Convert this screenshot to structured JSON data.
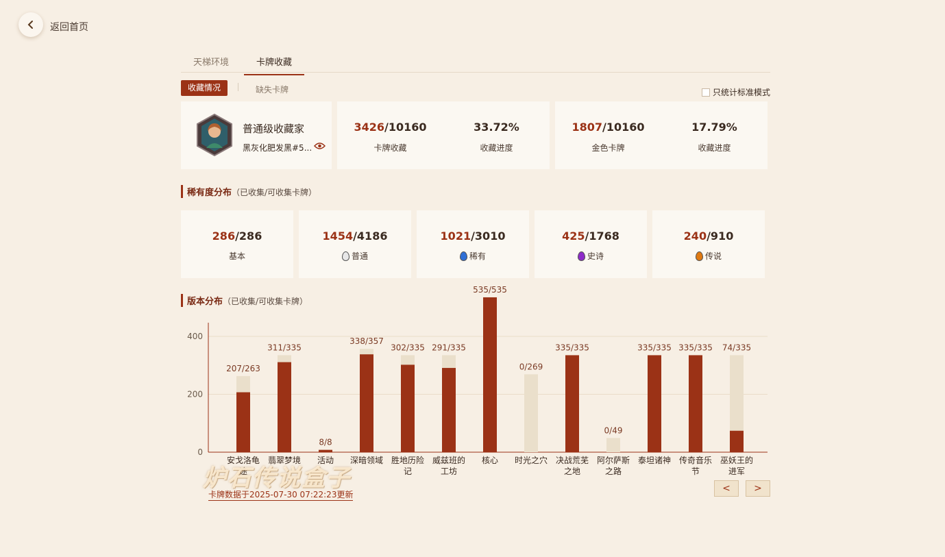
{
  "nav": {
    "back_label": "返回首页"
  },
  "tabs": [
    {
      "label": "天梯环境"
    },
    {
      "label": "卡牌收藏"
    }
  ],
  "subtabs": {
    "active": "收藏情况",
    "other": "缺失卡牌"
  },
  "standard_only_label": "只统计标准模式",
  "profile": {
    "title": "普通级收藏家",
    "player": "黑灰化肥发黑#5...",
    "eye_icon": "eye-icon",
    "accent": "#9b3216"
  },
  "stats": {
    "cards": {
      "owned": "3426",
      "total": "/10160",
      "label": "卡牌收藏",
      "pct": "33.72%",
      "pct_label": "收藏进度"
    },
    "golden": {
      "owned": "1807",
      "total": "/10160",
      "label": "金色卡牌",
      "pct": "17.79%",
      "pct_label": "收藏进度"
    }
  },
  "rarity_section": {
    "title": "稀有度分布",
    "note": "（已收集/可收集卡牌）"
  },
  "rarity": [
    {
      "owned": "286",
      "total": "/286",
      "label": "基本",
      "gem": ""
    },
    {
      "owned": "1454",
      "total": "/4186",
      "label": "普通",
      "gem": "#e8e8e8"
    },
    {
      "owned": "1021",
      "total": "/3010",
      "label": "稀有",
      "gem": "#2f6fd6"
    },
    {
      "owned": "425",
      "total": "/1768",
      "label": "史诗",
      "gem": "#8e2bc9"
    },
    {
      "owned": "240",
      "total": "/910",
      "label": "传说",
      "gem": "#e07a12"
    }
  ],
  "version_section": {
    "title": "版本分布",
    "note": "（已收集/可收集卡牌）"
  },
  "chart_data": {
    "type": "bar",
    "categories": [
      "安戈洛龟途",
      "翡翠梦境",
      "活动",
      "深暗领域",
      "胜地历险记",
      "威兹班的工坊",
      "核心",
      "时光之穴",
      "决战荒芜之地",
      "阿尔萨斯之路",
      "泰坦诸神",
      "传奇音乐节",
      "巫妖王的进军"
    ],
    "category_lines": [
      [
        "安戈洛龟",
        "途"
      ],
      [
        "翡翠梦境"
      ],
      [
        "活动"
      ],
      [
        "深暗领域"
      ],
      [
        "胜地历险",
        "记"
      ],
      [
        "威兹班的",
        "工坊"
      ],
      [
        "核心"
      ],
      [
        "时光之穴"
      ],
      [
        "决战荒芜",
        "之地"
      ],
      [
        "阿尔萨斯",
        "之路"
      ],
      [
        "泰坦诸神"
      ],
      [
        "传奇音乐",
        "节"
      ],
      [
        "巫妖王的",
        "进军"
      ]
    ],
    "series": [
      {
        "name": "已收集",
        "values": [
          207,
          311,
          8,
          338,
          302,
          291,
          535,
          0,
          335,
          0,
          335,
          335,
          74
        ]
      },
      {
        "name": "可收集",
        "values": [
          263,
          335,
          8,
          357,
          335,
          335,
          535,
          269,
          335,
          49,
          335,
          335,
          335
        ]
      }
    ],
    "bar_labels": [
      "207/263",
      "311/335",
      "8/8",
      "338/357",
      "302/335",
      "291/335",
      "535/535",
      "0/269",
      "335/335",
      "0/49",
      "335/335",
      "335/335",
      "74/335"
    ],
    "ylim": [
      0,
      400
    ],
    "yticks": [
      0,
      200,
      400
    ],
    "colors": {
      "owned": "#9b3216",
      "total": "#eadfcb",
      "grid": "#eadcc8",
      "axis": "#9b3216"
    }
  },
  "footer": {
    "update_text": "卡牌数据于2025-07-30 07:22:23更新",
    "prev": "<",
    "next": ">"
  },
  "watermark": "炉石传说盒子"
}
